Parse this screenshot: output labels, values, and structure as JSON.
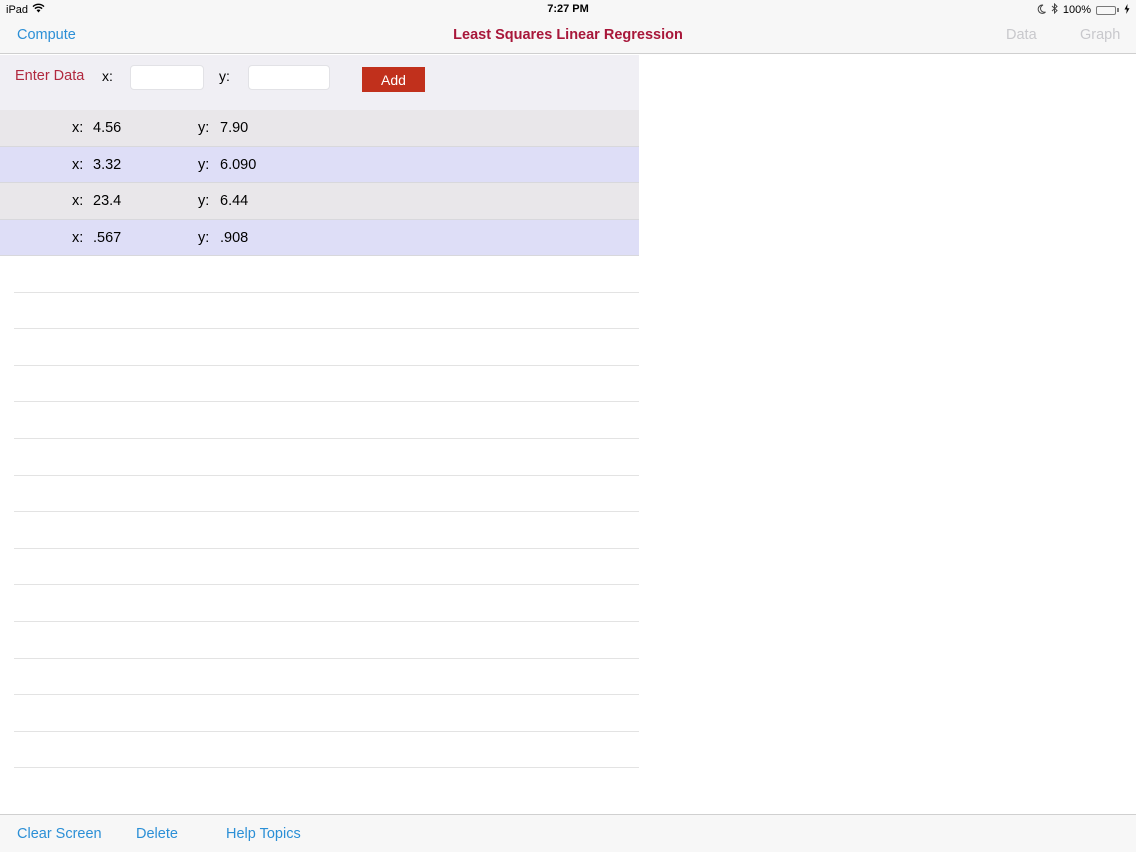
{
  "status_bar": {
    "device": "iPad",
    "time": "7:27 PM",
    "battery_percent": "100%",
    "battery_level": 1.0,
    "icons": [
      "wifi-icon",
      "moon-icon",
      "bluetooth-icon",
      "battery-icon",
      "charging-icon"
    ]
  },
  "nav": {
    "left_button": "Compute",
    "title": "Least Squares Linear Regression",
    "right_buttons": [
      "Data",
      "Graph"
    ]
  },
  "entry": {
    "label": "Enter Data",
    "x_label": "x:",
    "y_label": "y:",
    "x_value": "",
    "y_value": "",
    "add_label": "Add"
  },
  "rows": [
    {
      "x_label": "x:",
      "x": "4.56",
      "y_label": "y:",
      "y": "7.90"
    },
    {
      "x_label": "x:",
      "x": "3.32",
      "y_label": "y:",
      "y": "6.090"
    },
    {
      "x_label": "x:",
      "x": "23.4",
      "y_label": "y:",
      "y": "6.44"
    },
    {
      "x_label": "x:",
      "x": ".567",
      "y_label": "y:",
      "y": ".908"
    }
  ],
  "toolbar": {
    "clear": "Clear Screen",
    "delete": "Delete",
    "help": "Help Topics"
  },
  "colors": {
    "accent_blue": "#2b8fd6",
    "title_red": "#a8173a",
    "add_button": "#c1301c",
    "row_odd": "#e9e7ea",
    "row_even": "#dedef7",
    "disabled": "#c8c8cc"
  }
}
